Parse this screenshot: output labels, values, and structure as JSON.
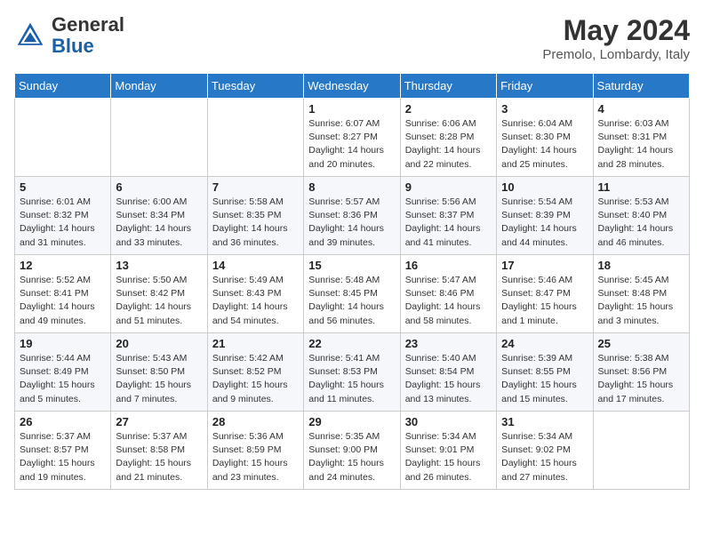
{
  "header": {
    "logo_general": "General",
    "logo_blue": "Blue",
    "month_title": "May 2024",
    "location": "Premolo, Lombardy, Italy"
  },
  "days_of_week": [
    "Sunday",
    "Monday",
    "Tuesday",
    "Wednesday",
    "Thursday",
    "Friday",
    "Saturday"
  ],
  "weeks": [
    [
      {
        "day": "",
        "info": ""
      },
      {
        "day": "",
        "info": ""
      },
      {
        "day": "",
        "info": ""
      },
      {
        "day": "1",
        "info": "Sunrise: 6:07 AM\nSunset: 8:27 PM\nDaylight: 14 hours\nand 20 minutes."
      },
      {
        "day": "2",
        "info": "Sunrise: 6:06 AM\nSunset: 8:28 PM\nDaylight: 14 hours\nand 22 minutes."
      },
      {
        "day": "3",
        "info": "Sunrise: 6:04 AM\nSunset: 8:30 PM\nDaylight: 14 hours\nand 25 minutes."
      },
      {
        "day": "4",
        "info": "Sunrise: 6:03 AM\nSunset: 8:31 PM\nDaylight: 14 hours\nand 28 minutes."
      }
    ],
    [
      {
        "day": "5",
        "info": "Sunrise: 6:01 AM\nSunset: 8:32 PM\nDaylight: 14 hours\nand 31 minutes."
      },
      {
        "day": "6",
        "info": "Sunrise: 6:00 AM\nSunset: 8:34 PM\nDaylight: 14 hours\nand 33 minutes."
      },
      {
        "day": "7",
        "info": "Sunrise: 5:58 AM\nSunset: 8:35 PM\nDaylight: 14 hours\nand 36 minutes."
      },
      {
        "day": "8",
        "info": "Sunrise: 5:57 AM\nSunset: 8:36 PM\nDaylight: 14 hours\nand 39 minutes."
      },
      {
        "day": "9",
        "info": "Sunrise: 5:56 AM\nSunset: 8:37 PM\nDaylight: 14 hours\nand 41 minutes."
      },
      {
        "day": "10",
        "info": "Sunrise: 5:54 AM\nSunset: 8:39 PM\nDaylight: 14 hours\nand 44 minutes."
      },
      {
        "day": "11",
        "info": "Sunrise: 5:53 AM\nSunset: 8:40 PM\nDaylight: 14 hours\nand 46 minutes."
      }
    ],
    [
      {
        "day": "12",
        "info": "Sunrise: 5:52 AM\nSunset: 8:41 PM\nDaylight: 14 hours\nand 49 minutes."
      },
      {
        "day": "13",
        "info": "Sunrise: 5:50 AM\nSunset: 8:42 PM\nDaylight: 14 hours\nand 51 minutes."
      },
      {
        "day": "14",
        "info": "Sunrise: 5:49 AM\nSunset: 8:43 PM\nDaylight: 14 hours\nand 54 minutes."
      },
      {
        "day": "15",
        "info": "Sunrise: 5:48 AM\nSunset: 8:45 PM\nDaylight: 14 hours\nand 56 minutes."
      },
      {
        "day": "16",
        "info": "Sunrise: 5:47 AM\nSunset: 8:46 PM\nDaylight: 14 hours\nand 58 minutes."
      },
      {
        "day": "17",
        "info": "Sunrise: 5:46 AM\nSunset: 8:47 PM\nDaylight: 15 hours\nand 1 minute."
      },
      {
        "day": "18",
        "info": "Sunrise: 5:45 AM\nSunset: 8:48 PM\nDaylight: 15 hours\nand 3 minutes."
      }
    ],
    [
      {
        "day": "19",
        "info": "Sunrise: 5:44 AM\nSunset: 8:49 PM\nDaylight: 15 hours\nand 5 minutes."
      },
      {
        "day": "20",
        "info": "Sunrise: 5:43 AM\nSunset: 8:50 PM\nDaylight: 15 hours\nand 7 minutes."
      },
      {
        "day": "21",
        "info": "Sunrise: 5:42 AM\nSunset: 8:52 PM\nDaylight: 15 hours\nand 9 minutes."
      },
      {
        "day": "22",
        "info": "Sunrise: 5:41 AM\nSunset: 8:53 PM\nDaylight: 15 hours\nand 11 minutes."
      },
      {
        "day": "23",
        "info": "Sunrise: 5:40 AM\nSunset: 8:54 PM\nDaylight: 15 hours\nand 13 minutes."
      },
      {
        "day": "24",
        "info": "Sunrise: 5:39 AM\nSunset: 8:55 PM\nDaylight: 15 hours\nand 15 minutes."
      },
      {
        "day": "25",
        "info": "Sunrise: 5:38 AM\nSunset: 8:56 PM\nDaylight: 15 hours\nand 17 minutes."
      }
    ],
    [
      {
        "day": "26",
        "info": "Sunrise: 5:37 AM\nSunset: 8:57 PM\nDaylight: 15 hours\nand 19 minutes."
      },
      {
        "day": "27",
        "info": "Sunrise: 5:37 AM\nSunset: 8:58 PM\nDaylight: 15 hours\nand 21 minutes."
      },
      {
        "day": "28",
        "info": "Sunrise: 5:36 AM\nSunset: 8:59 PM\nDaylight: 15 hours\nand 23 minutes."
      },
      {
        "day": "29",
        "info": "Sunrise: 5:35 AM\nSunset: 9:00 PM\nDaylight: 15 hours\nand 24 minutes."
      },
      {
        "day": "30",
        "info": "Sunrise: 5:34 AM\nSunset: 9:01 PM\nDaylight: 15 hours\nand 26 minutes."
      },
      {
        "day": "31",
        "info": "Sunrise: 5:34 AM\nSunset: 9:02 PM\nDaylight: 15 hours\nand 27 minutes."
      },
      {
        "day": "",
        "info": ""
      }
    ]
  ]
}
